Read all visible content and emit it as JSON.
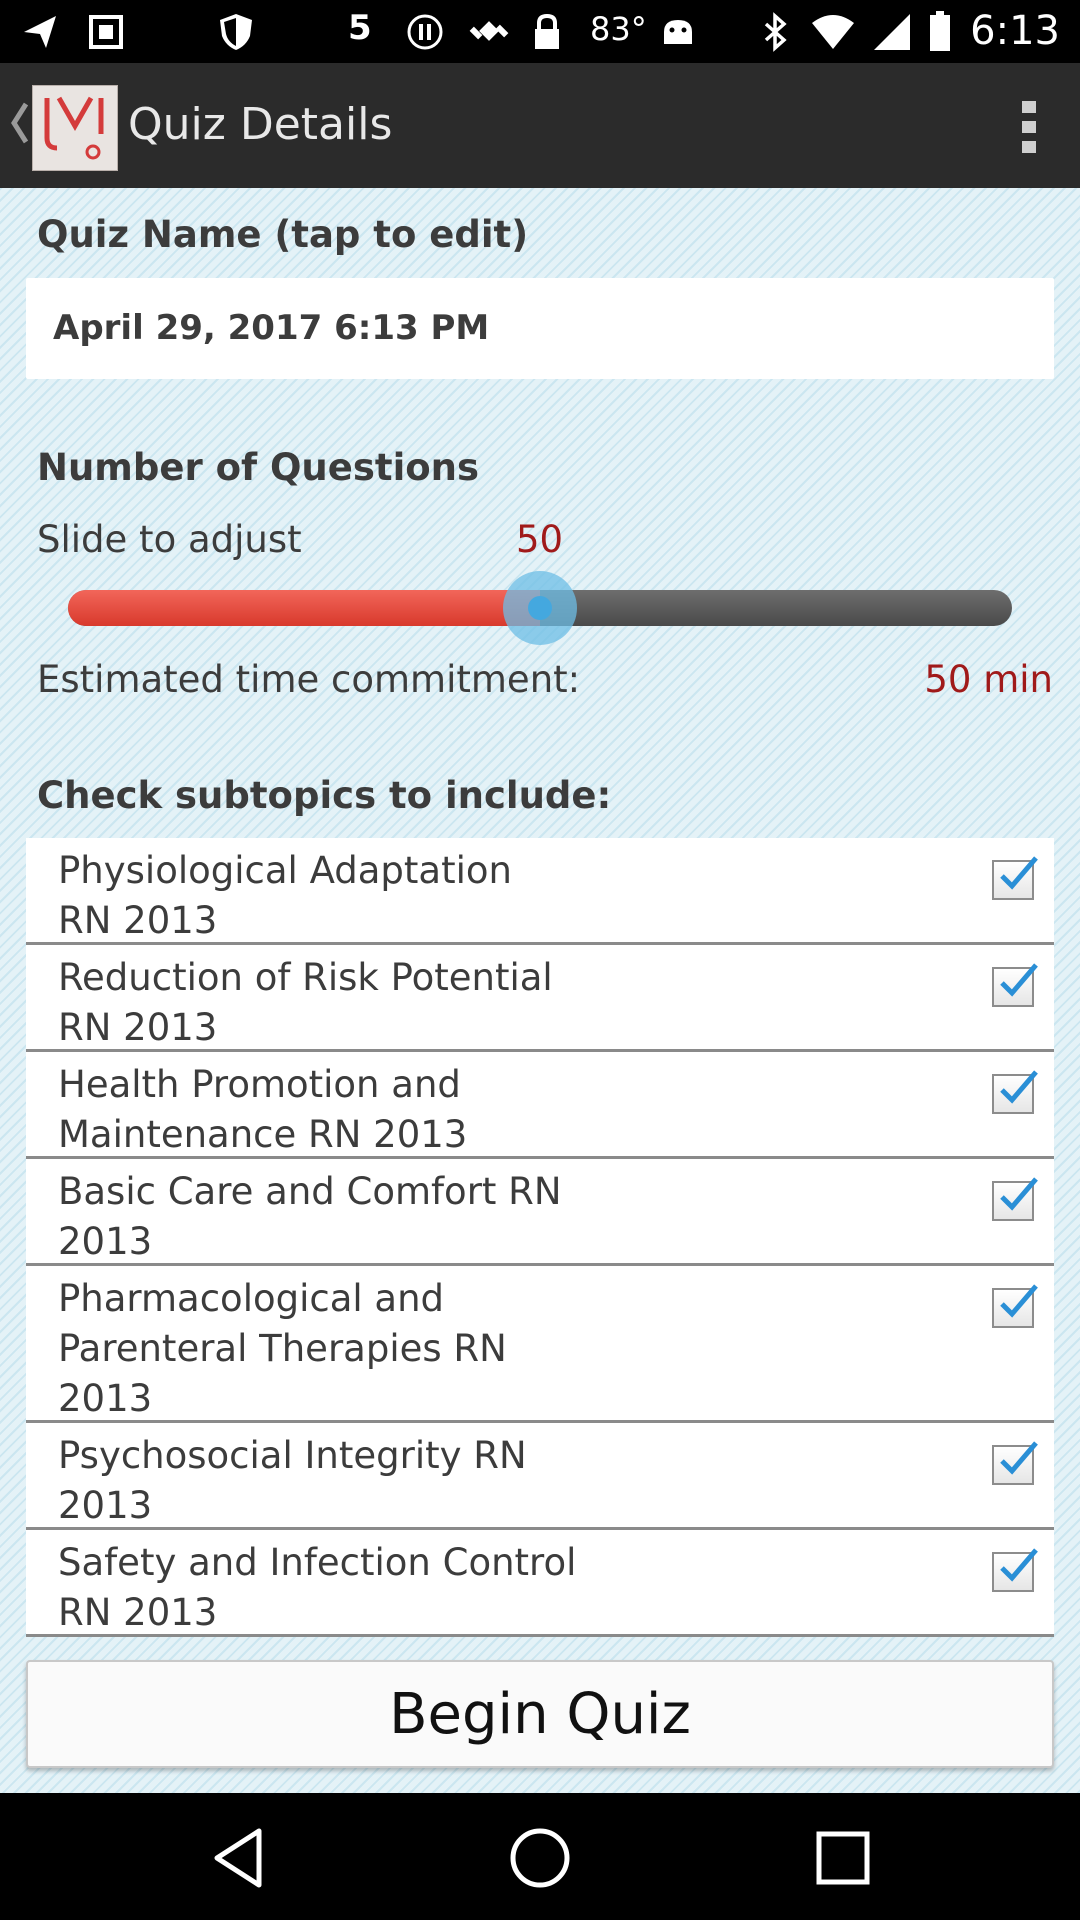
{
  "status_bar": {
    "time": "6:13",
    "temperature": "83°",
    "notification_number": "5",
    "icons": [
      "send-icon",
      "image-icon",
      "shield-icon",
      "number-5-icon",
      "pause-icon",
      "satellite-icon",
      "lock-icon",
      "temperature-text",
      "android-icon",
      "bluetooth-icon",
      "wifi-icon",
      "signal-icon",
      "battery-icon"
    ]
  },
  "app_bar": {
    "title": "Quiz Details",
    "icons": [
      "back-icon",
      "app-logo",
      "overflow-menu-icon"
    ]
  },
  "quiz_name": {
    "label": "Quiz Name (tap to edit)",
    "value": "April 29, 2017 6:13  PM"
  },
  "questions": {
    "label": "Number of Questions",
    "slide_label": "Slide to adjust",
    "value": "50",
    "slider_fraction": 0.5
  },
  "estimate": {
    "label": "Estimated time commitment:",
    "value": "50 min"
  },
  "subtopics": {
    "label": "Check subtopics to include:",
    "items": [
      {
        "label": "Physiological Adaptation\nRN 2013",
        "checked": true
      },
      {
        "label": "Reduction of Risk Potential\nRN 2013",
        "checked": true
      },
      {
        "label": "Health Promotion and\nMaintenance RN 2013",
        "checked": true
      },
      {
        "label": "Basic Care and Comfort RN\n2013",
        "checked": true
      },
      {
        "label": "Pharmacological and\nParenteral Therapies RN\n2013",
        "checked": true
      },
      {
        "label": "Psychosocial Integrity RN\n2013",
        "checked": true
      },
      {
        "label": "Safety and Infection Control\nRN 2013",
        "checked": true
      }
    ]
  },
  "begin_button": {
    "label": "Begin Quiz"
  },
  "colors": {
    "accent_red": "#a01a1a",
    "slider_fill": "#e04a3c",
    "slider_thumb": "#44a8df",
    "check_blue": "#2a8fd6",
    "background": "#dbeef5"
  }
}
